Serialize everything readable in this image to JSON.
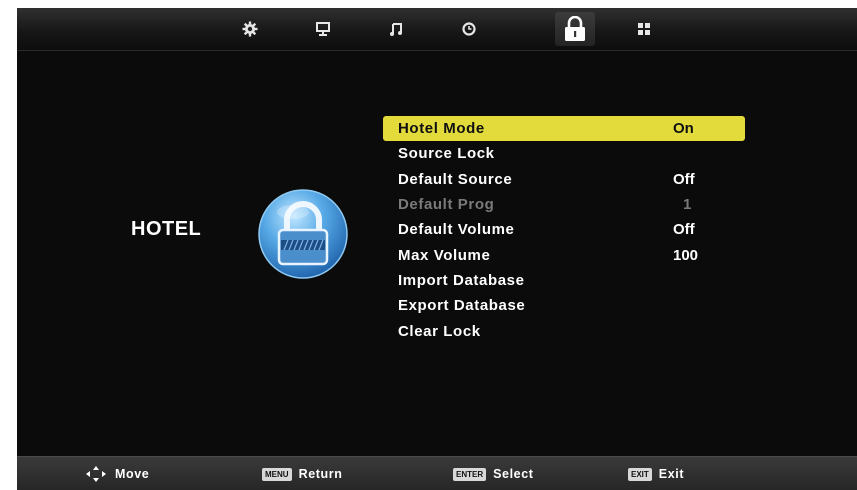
{
  "tabs": [
    {
      "icon": "gear-icon",
      "active": false
    },
    {
      "icon": "monitor-icon",
      "active": false
    },
    {
      "icon": "music-note-icon",
      "active": false
    },
    {
      "icon": "clock-icon",
      "active": false
    },
    {
      "icon": "lock-icon",
      "active": true
    },
    {
      "icon": "grid-icon",
      "active": false
    }
  ],
  "page": {
    "title": "HOTEL",
    "icon": "padlock-icon"
  },
  "menu": {
    "items": [
      {
        "label": "Hotel Mode",
        "value": "On",
        "state": "selected"
      },
      {
        "label": "Source Lock",
        "value": "",
        "state": "normal"
      },
      {
        "label": "Default Source",
        "value": "Off",
        "state": "normal"
      },
      {
        "label": "Default Prog",
        "value": "1",
        "state": "disabled"
      },
      {
        "label": "Default Volume",
        "value": "Off",
        "state": "normal"
      },
      {
        "label": "Max Volume",
        "value": "100",
        "state": "normal"
      },
      {
        "label": "Import Database",
        "value": "",
        "state": "normal"
      },
      {
        "label": "Export Database",
        "value": "",
        "state": "normal"
      },
      {
        "label": "Clear Lock",
        "value": "",
        "state": "normal"
      }
    ]
  },
  "hints": [
    {
      "icon": "dpad-icon",
      "key": "",
      "label": "Move"
    },
    {
      "icon": "",
      "key": "MENU",
      "label": "Return"
    },
    {
      "icon": "",
      "key": "ENTER",
      "label": "Select"
    },
    {
      "icon": "",
      "key": "EXIT",
      "label": "Exit"
    }
  ],
  "colors": {
    "highlight": "#e2db3b",
    "background": "#0b0b0b",
    "icon_blue": "#3d8fd0"
  }
}
